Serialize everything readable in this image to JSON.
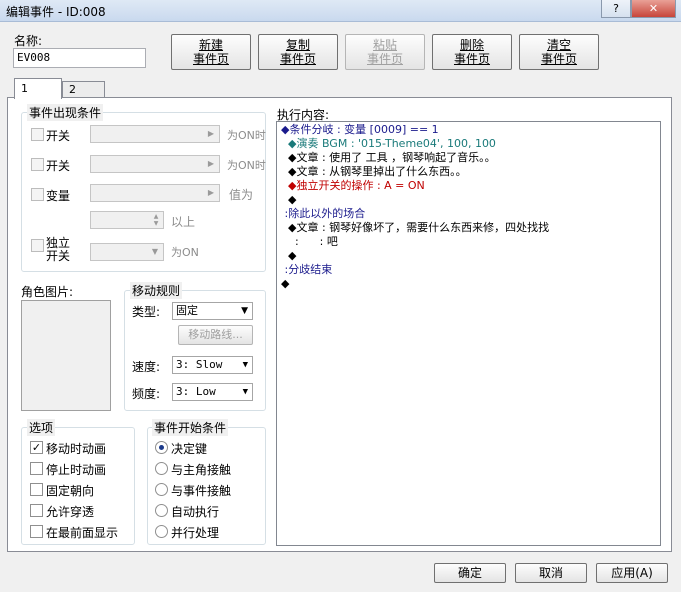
{
  "window": {
    "title": "编辑事件 - ID:008",
    "help": "?",
    "close": "✕"
  },
  "name": {
    "label": "名称:",
    "value": "EV008"
  },
  "toolbar": [
    {
      "l1": "新建",
      "l2": "事件页",
      "enabled": true
    },
    {
      "l1": "复制",
      "l2": "事件页",
      "enabled": true
    },
    {
      "l1": "粘贴",
      "l2": "事件页",
      "enabled": false
    },
    {
      "l1": "删除",
      "l2": "事件页",
      "enabled": true
    },
    {
      "l1": "清空",
      "l2": "事件页",
      "enabled": true
    }
  ],
  "tabs": [
    "1",
    "2"
  ],
  "conditions": {
    "title": "事件出现条件",
    "switch1": "开关",
    "switch1_suffix": "为ON时",
    "switch2": "开关",
    "switch2_suffix": "为ON时",
    "variable": "变量",
    "variable_suffix": "值为",
    "above": "以上",
    "self_switch_l1": "独立",
    "self_switch_l2": "开关",
    "self_switch_suffix": "为ON"
  },
  "graphic": {
    "title": "角色图片:"
  },
  "movement": {
    "title": "移动规则",
    "type_label": "类型:",
    "type_value": "固定",
    "route_button": "移动路线...",
    "speed_label": "速度:",
    "speed_value": "3: Slow",
    "freq_label": "频度:",
    "freq_value": "3: Low"
  },
  "options": {
    "title": "选项",
    "items": [
      {
        "label": "移动时动画",
        "checked": true
      },
      {
        "label": "停止时动画",
        "checked": false
      },
      {
        "label": "固定朝向",
        "checked": false
      },
      {
        "label": "允许穿透",
        "checked": false
      },
      {
        "label": "在最前面显示",
        "checked": false
      }
    ]
  },
  "trigger": {
    "title": "事件开始条件",
    "items": [
      {
        "label": "决定键",
        "selected": true
      },
      {
        "label": "与主角接触",
        "selected": false
      },
      {
        "label": "与事件接触",
        "selected": false
      },
      {
        "label": "自动执行",
        "selected": false
      },
      {
        "label": "并行处理",
        "selected": false
      }
    ]
  },
  "contents": {
    "title": "执行内容:",
    "lines": [
      {
        "text": "◆条件分岐 : 变量 [0009] == 1",
        "color": "#1a1a8c"
      },
      {
        "text": "  ◆演奏 BGM : '015-Theme04', 100, 100",
        "color": "#1a7a7a"
      },
      {
        "text": "  ◆文章 : 使用了 工具 ，钢琴响起了音乐。。",
        "color": "#000000"
      },
      {
        "text": "  ◆文章 : 从钢琴里掉出了什么东西。。",
        "color": "#000000"
      },
      {
        "text": "  ◆独立开关的操作 : A = ON",
        "color": "#c00000"
      },
      {
        "text": "  ◆",
        "color": "#000000"
      },
      {
        "text": " :除此以外的场合",
        "color": "#1a1a8c"
      },
      {
        "text": "  ◆文章 : 钢琴好像坏了，需要什么东西来修，四处找找",
        "color": "#000000"
      },
      {
        "text": "    :      : 吧",
        "color": "#000000"
      },
      {
        "text": "  ◆",
        "color": "#000000"
      },
      {
        "text": " :分歧结束",
        "color": "#1a1a8c"
      },
      {
        "text": "◆",
        "color": "#000000"
      }
    ]
  },
  "footer": {
    "ok": "确定",
    "cancel": "取消",
    "apply": "应用(A)"
  }
}
